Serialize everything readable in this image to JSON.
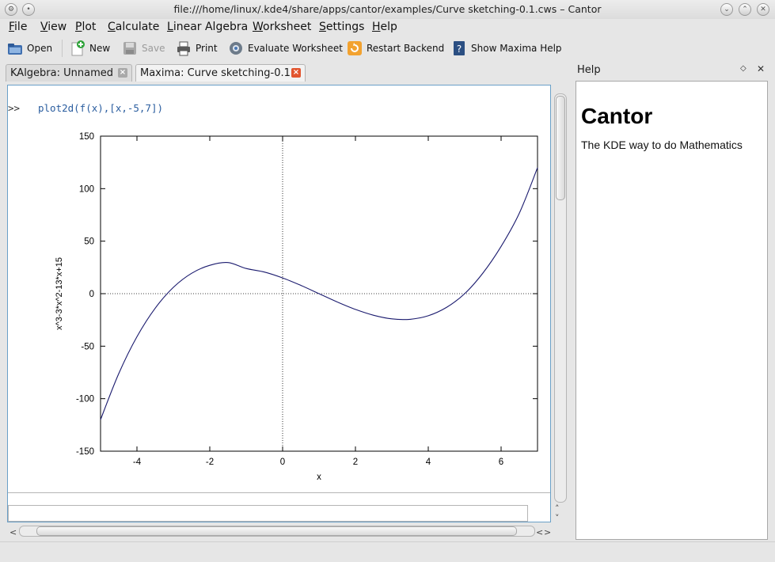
{
  "window": {
    "title": "file:///home/linux/.kde4/share/apps/cantor/examples/Curve sketching-0.1.cws – Cantor"
  },
  "menubar": {
    "items": [
      "File",
      "View",
      "Plot",
      "Calculate",
      "Linear Algebra",
      "Worksheet",
      "Settings",
      "Help"
    ]
  },
  "toolbar": {
    "open": "Open",
    "new": "New",
    "save": "Save",
    "print": "Print",
    "evaluate": "Evaluate Worksheet",
    "restart": "Restart Backend",
    "maxima_help": "Show Maxima Help"
  },
  "tabs": [
    {
      "label": "KAlgebra: Unnamed",
      "active": false
    },
    {
      "label": "Maxima: Curve sketching-0.1",
      "active": true
    }
  ],
  "worksheet": {
    "prompt": ">>",
    "command": "plot2d(f(x),[x,-5,7])"
  },
  "help": {
    "dock_title": "Help",
    "heading": "Cantor",
    "body": "The KDE way to do Mathematics"
  },
  "chart_data": {
    "type": "line",
    "title": "",
    "xlabel": "x",
    "ylabel": "x^3-3*x^2-13*x+15",
    "xlim": [
      -5,
      7
    ],
    "ylim": [
      -150,
      150
    ],
    "x_ticks": [
      -4,
      -2,
      0,
      2,
      4,
      6
    ],
    "y_ticks": [
      -150,
      -100,
      -50,
      0,
      50,
      100,
      150
    ],
    "series": [
      {
        "color": "#1a1a6e",
        "x": [
          -5,
          -4.5,
          -4,
          -3.5,
          -3,
          -2.5,
          -2,
          -1.5,
          -1,
          -0.5,
          0,
          0.5,
          1,
          1.5,
          2,
          2.5,
          3,
          3.5,
          4,
          4.5,
          5,
          5.5,
          6,
          6.5,
          7
        ],
        "y": [
          -120,
          -76.1,
          -41,
          -13.9,
          6,
          19.4,
          27,
          29.6,
          24,
          20.6,
          15,
          7.9,
          0,
          -7.9,
          -15,
          -20.6,
          -24,
          -24.4,
          -21,
          -13.1,
          0,
          19.6,
          45,
          76.6,
          120
        ]
      }
    ],
    "zero_lines": true
  }
}
